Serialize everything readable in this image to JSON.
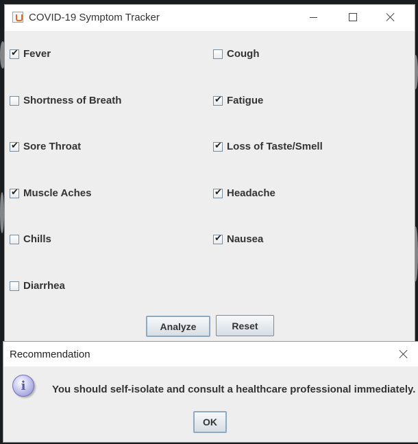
{
  "window": {
    "title": "COVID-19 Symptom Tracker"
  },
  "symptoms": [
    {
      "label": "Fever",
      "checked": true
    },
    {
      "label": "Cough",
      "checked": false
    },
    {
      "label": "Shortness of Breath",
      "checked": false
    },
    {
      "label": "Fatigue",
      "checked": true
    },
    {
      "label": "Sore Throat",
      "checked": true
    },
    {
      "label": "Loss of Taste/Smell",
      "checked": true
    },
    {
      "label": "Muscle Aches",
      "checked": true
    },
    {
      "label": "Headache",
      "checked": true
    },
    {
      "label": "Chills",
      "checked": false
    },
    {
      "label": "Nausea",
      "checked": true
    },
    {
      "label": "Diarrhea",
      "checked": false
    }
  ],
  "buttons": {
    "analyze": "Analyze",
    "reset": "Reset"
  },
  "dialog": {
    "title": "Recommendation",
    "icon": "i",
    "message": "You should self-isolate and consult a healthcare professional immediately.",
    "ok": "OK"
  },
  "check_glyph": "✔"
}
